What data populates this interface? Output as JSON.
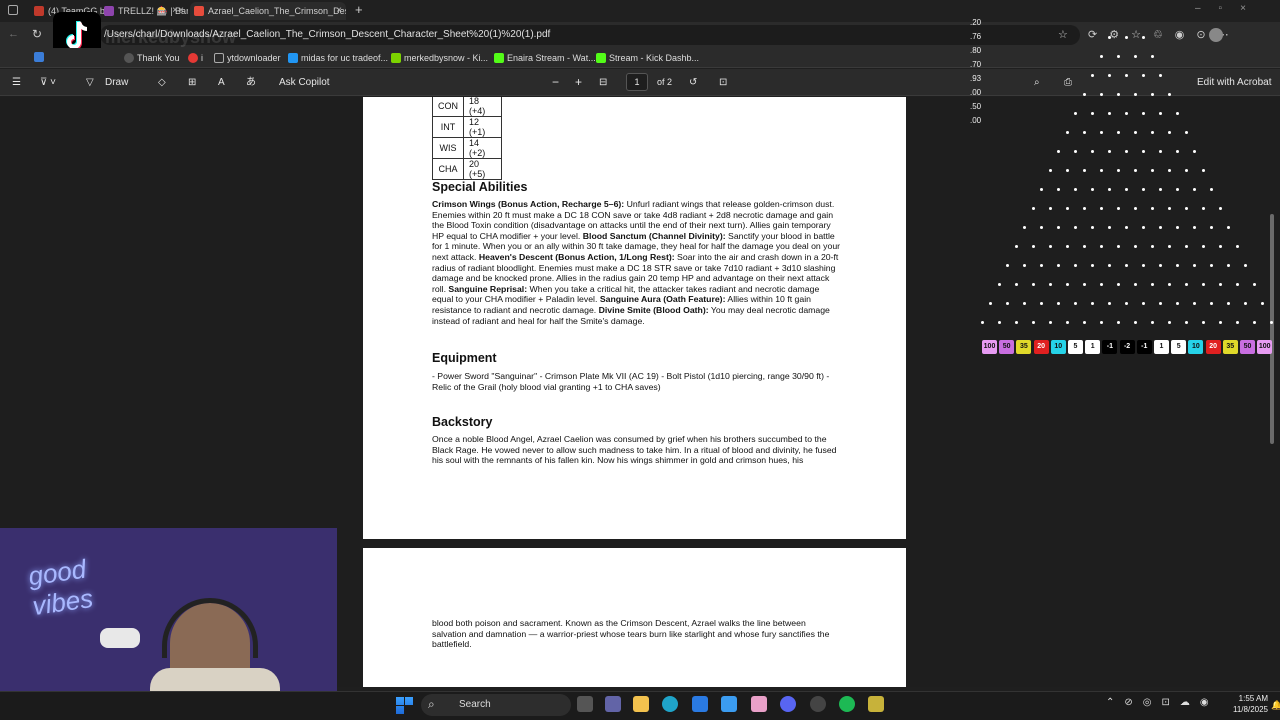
{
  "tabs": [
    {
      "label": "(4) TeamGG by",
      "color": "#c0392b"
    },
    {
      "label": "TRELLZ! 🎰 | Ban",
      "color": "#8e44ad"
    },
    {
      "label": "Azrael_Caelion_The_Crimson_Des",
      "color": "#e74c3c",
      "active": true
    }
  ],
  "new_tab": "+",
  "overlay_channel": "merkedbysnow",
  "url": "/Users/charl/Downloads/Azrael_Caelion_The_Crimson_Descent_Character_Sheet%20(1)%20(1).pdf",
  "bookmarks": [
    {
      "label": "Thank You",
      "color": "#555"
    },
    {
      "label": "i",
      "color": "#e53935"
    },
    {
      "label": "ytdownloader",
      "color": "#888"
    },
    {
      "label": "midas for uc tradeof...",
      "color": "#2196f3"
    },
    {
      "label": "merkedbysnow - Ki...",
      "color": "#7cd300"
    },
    {
      "label": "Enaira Stream - Wat...",
      "color": "#53fc18"
    },
    {
      "label": "Stream - Kick Dashb...",
      "color": "#53fc18"
    }
  ],
  "pdf_toolbar": {
    "draw": "Draw",
    "copilot": "Ask Copilot",
    "zoom_out": "−",
    "zoom_in": "+",
    "page_current": "1",
    "page_total": "of 2",
    "edit": "Edit with Acrobat"
  },
  "stats": [
    {
      "attr": "CON",
      "value": "18 (+4)"
    },
    {
      "attr": "INT",
      "value": "12 (+1)"
    },
    {
      "attr": "WIS",
      "value": "14 (+2)"
    },
    {
      "attr": "CHA",
      "value": "20 (+5)"
    }
  ],
  "sections": {
    "special_title": "Special Abilities",
    "special": [
      {
        "b": "Crimson Wings (Bonus Action, Recharge 5–6):",
        "t": " Unfurl radiant wings that release golden-crimson dust. Enemies within 20 ft must make a DC 18 CON save or take 4d8 radiant + 2d8 necrotic damage and gain the Blood Toxin condition (disadvantage on attacks until the end of their next turn). Allies gain temporary HP equal to CHA modifier + your level. "
      },
      {
        "b": "Blood Sanctum (Channel Divinity):",
        "t": " Sanctify your blood in battle for 1 minute. When you or an ally within 30 ft take damage, they heal for half the damage you deal on your next attack. "
      },
      {
        "b": "Heaven's Descent (Bonus Action, 1/Long Rest):",
        "t": " Soar into the air and crash down in a 20-ft radius of radiant bloodlight. Enemies must make a DC 18 STR save or take 7d10 radiant + 3d10 slashing damage and be knocked prone. Allies in the radius gain 20 temp HP and advantage on their next attack roll. "
      },
      {
        "b": "Sanguine Reprisal:",
        "t": " When you take a critical hit, the attacker takes radiant and necrotic damage equal to your CHA modifier + Paladin level. "
      },
      {
        "b": "Sanguine Aura (Oath Feature):",
        "t": " Allies within 10 ft gain resistance to radiant and necrotic damage. "
      },
      {
        "b": "Divine Smite (Blood Oath):",
        "t": " You may deal necrotic damage instead of radiant and heal for half the Smite's damage."
      }
    ],
    "equipment_title": "Equipment",
    "equipment": "- Power Sword \"Sanguinar\" - Crimson Plate Mk VII (AC 19) - Bolt Pistol (1d10 piercing, range 30/90 ft) - Relic of the Grail (holy blood vial granting +1 to CHA saves)",
    "backstory_title": "Backstory",
    "backstory": "Once a noble Blood Angel, Azrael Caelion was consumed by grief when his brothers succumbed to the Black Rage. He vowed never to allow such madness to take him. In a ritual of blood and divinity, he fused his soul with the remnants of his fallen kin. Now his wings shimmer in gold and crimson hues, his",
    "backstory_cont": "blood both poison and sacrament. Known as the Crimson Descent, Azrael walks the line between salvation and damnation — a warrior-priest whose tears burn like starlight and whose fury sanctifies the battlefield."
  },
  "plinko": {
    "odds": [
      ".20",
      ".76",
      ".80",
      ".70",
      ".93",
      ".00",
      ".50",
      ".00"
    ],
    "multipliers": [
      {
        "v": "100",
        "c": "#e79bf2"
      },
      {
        "v": "50",
        "c": "#c86ee0"
      },
      {
        "v": "35",
        "c": "#e0d92a"
      },
      {
        "v": "20",
        "c": "#e02020"
      },
      {
        "v": "10",
        "c": "#26d3e8"
      },
      {
        "v": "5",
        "c": "#ffffff"
      },
      {
        "v": "1",
        "c": "#ffffff"
      },
      {
        "v": "-1",
        "c": "#000000"
      },
      {
        "v": "-2",
        "c": "#000000"
      },
      {
        "v": "-1",
        "c": "#000000"
      },
      {
        "v": "1",
        "c": "#ffffff"
      },
      {
        "v": "5",
        "c": "#ffffff"
      },
      {
        "v": "10",
        "c": "#26d3e8"
      },
      {
        "v": "20",
        "c": "#e02020"
      },
      {
        "v": "35",
        "c": "#e0d92a"
      },
      {
        "v": "50",
        "c": "#c86ee0"
      },
      {
        "v": "100",
        "c": "#e79bf2"
      }
    ]
  },
  "webcam_sign": "good vibes",
  "taskbar": {
    "search": "Search",
    "time": "1:55 AM",
    "date": "11/8/2025"
  }
}
